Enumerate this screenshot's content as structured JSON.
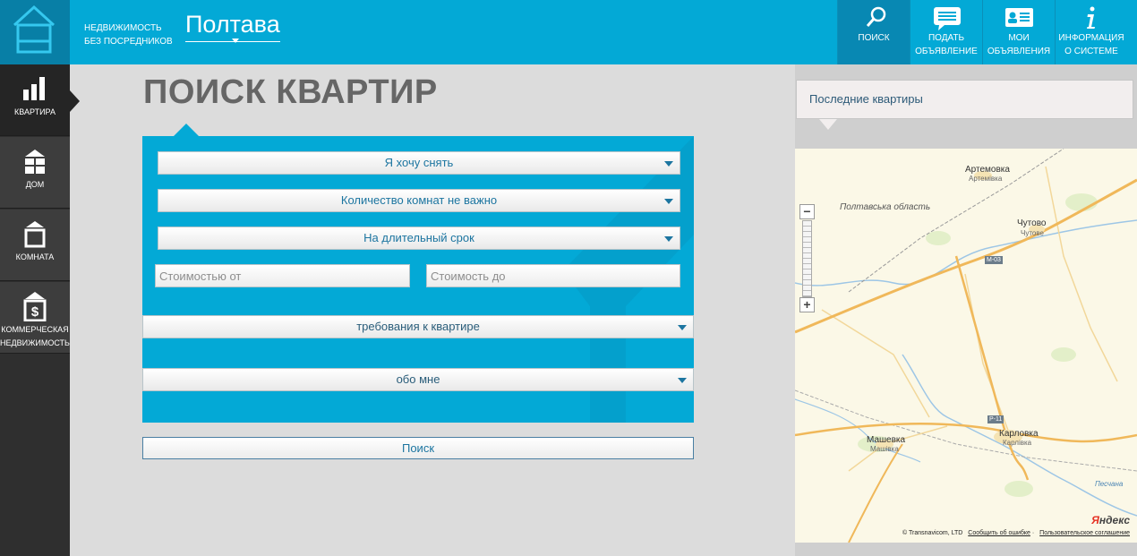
{
  "header": {
    "tagline": "НЕДВИЖИМОСТЬ БЕЗ ПОСРЕДНИКОВ",
    "city": "Полтава",
    "nav": [
      {
        "line1": "ПОИСК",
        "line2": "",
        "icon": "search-icon",
        "active": true
      },
      {
        "line1": "ПОДАТЬ",
        "line2": "ОБЪЯВЛЕНИЕ",
        "icon": "chat-bubble-icon",
        "active": false
      },
      {
        "line1": "МОИ",
        "line2": "ОБЪЯВЛЕНИЯ",
        "icon": "id-card-icon",
        "active": false
      },
      {
        "line1": "ИНФОРМАЦИЯ",
        "line2": "О СИСТЕМЕ",
        "icon": "info-icon",
        "active": false
      }
    ]
  },
  "sidebar": {
    "items": [
      {
        "label1": "КВАРТИРА",
        "label2": "",
        "icon": "bar-chart-icon",
        "active": true
      },
      {
        "label1": "ДОМ",
        "label2": "",
        "icon": "house-windows-icon",
        "active": false
      },
      {
        "label1": "КОМНАТА",
        "label2": "",
        "icon": "room-icon",
        "active": false
      },
      {
        "label1": "КОММЕРЧЕСКАЯ",
        "label2": "НЕДВИЖИМОСТЬ",
        "icon": "dollar-building-icon",
        "active": false
      }
    ]
  },
  "main": {
    "title": "ПОИСК КВАРТИР",
    "form": {
      "deal_type": "Я хочу снять",
      "rooms": "Количество комнат не важно",
      "term": "На длительный срок",
      "price_from_placeholder": "Стоимостью от",
      "price_to_placeholder": "Стоимость до",
      "requirements": "требования к квартире",
      "about_me": "обо мне"
    },
    "search_button": "Поиск"
  },
  "right": {
    "latest_title": "Последние квартиры",
    "map": {
      "labels": {
        "artemovka": "Артемовка",
        "artemivka": "Артемівка",
        "region": "Полтавська область",
        "chutovo": "Чутово",
        "chutove": "Чутове",
        "mashevka": "Машевка",
        "mashivka": "Машівка",
        "karlovka": "Карловка",
        "karlivka": "Карлівка",
        "river": "Песчана",
        "road_m03": "М-03",
        "road_p11": "Р-11"
      },
      "zoom_minus": "−",
      "zoom_plus": "+",
      "copyright": "© Transnavicom, LTD",
      "report_error": "Сообщить об ошибке",
      "agreement": "Пользовательское соглашение",
      "brand_first": "Я",
      "brand_rest": "ндекс"
    }
  },
  "colors": {
    "accent": "#03a9d6",
    "accent_dark": "#087fa6",
    "sidebar": "#3d3d3d",
    "link": "#1c75a0"
  }
}
